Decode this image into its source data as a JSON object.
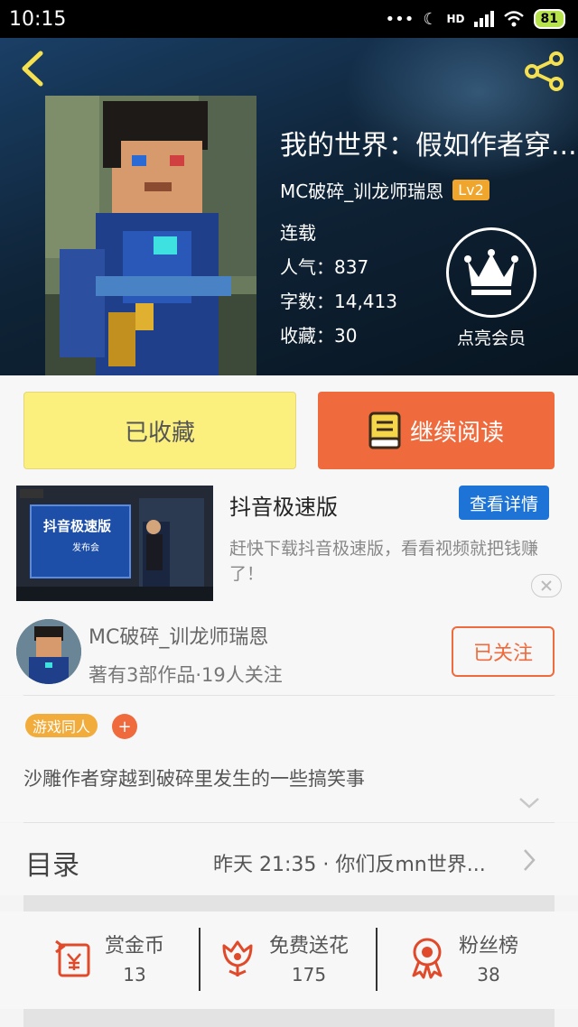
{
  "status_bar": {
    "time": "10:15",
    "battery": "81",
    "network": "HD"
  },
  "book": {
    "title": "我的世界：假如作者穿...",
    "author": "MC破碎_训龙师瑞恩",
    "level": "Lv2",
    "status": "连载",
    "popularity": "人气：837",
    "word_count": "字数：14,413",
    "favorites": "收藏：30"
  },
  "vip": {
    "label": "点亮会员"
  },
  "actions": {
    "collected_label": "已收藏",
    "read_label": "继续阅读"
  },
  "ad": {
    "title": "抖音极速版",
    "button": "查看详情",
    "description": "赶快下载抖音极速版，看看视频就把钱赚了！",
    "thumb_text": "抖音极速版",
    "thumb_sub": "发布会"
  },
  "author_card": {
    "name": "MC破碎_训龙师瑞恩",
    "meta": "著有3部作品·19人关注",
    "follow_label": "已关注"
  },
  "tags": {
    "items": [
      "游戏同人"
    ],
    "add_label": "+"
  },
  "intro": "沙雕作者穿越到破碎里发生的一些搞笑事",
  "catalog": {
    "title": "目录",
    "latest": "昨天 21:35 · 你们反mn世界..."
  },
  "stats": [
    {
      "label": "赏金币",
      "value": "13",
      "icon": "gift-money-icon"
    },
    {
      "label": "免费送花",
      "value": "175",
      "icon": "flower-icon"
    },
    {
      "label": "粉丝榜",
      "value": "38",
      "icon": "medal-icon"
    }
  ],
  "colors": {
    "accent": "#ef6a3c",
    "yellow": "#fbf07d",
    "blue": "#1e74d6",
    "tag": "#f2ac3b"
  }
}
